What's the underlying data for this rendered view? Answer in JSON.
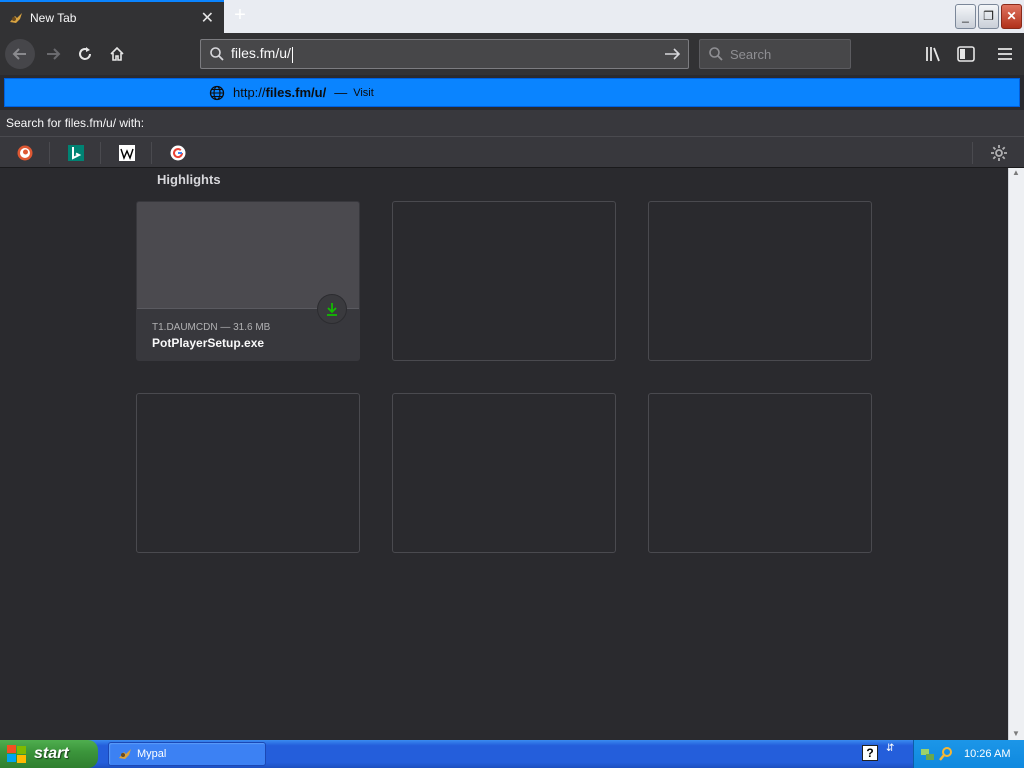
{
  "window": {
    "tab_title": "New Tab",
    "tab_close": "✕",
    "new_tab": "+",
    "controls": {
      "minimize": "_",
      "maximize": "❐",
      "close": "✕"
    }
  },
  "toolbar": {
    "url_value": "files.fm/u/",
    "search_placeholder": "Search"
  },
  "urlbar_popup": {
    "suggestion": {
      "url_prefix": "http://",
      "url_bold": "files.fm/u/",
      "separator": "—",
      "action": "Visit"
    },
    "search_with_label": "Search for files.fm/u/ with:",
    "engines": [
      "DuckDuckGo",
      "Bing",
      "Wikipedia",
      "Google"
    ]
  },
  "content": {
    "highlights_title": "Highlights",
    "cards": [
      {
        "host": "T1.DAUMCDN — 31.6 MB",
        "filename": "PotPlayerSetup.exe"
      }
    ]
  },
  "taskbar": {
    "start_label": "start",
    "task_label": "Mypal",
    "help_glyph": "?",
    "clock": "10:26 AM"
  },
  "colors": {
    "accent": "#0a84ff",
    "toolbar_bg": "#323234",
    "content_bg": "#2a2a2e",
    "download_green": "#12bc00"
  }
}
